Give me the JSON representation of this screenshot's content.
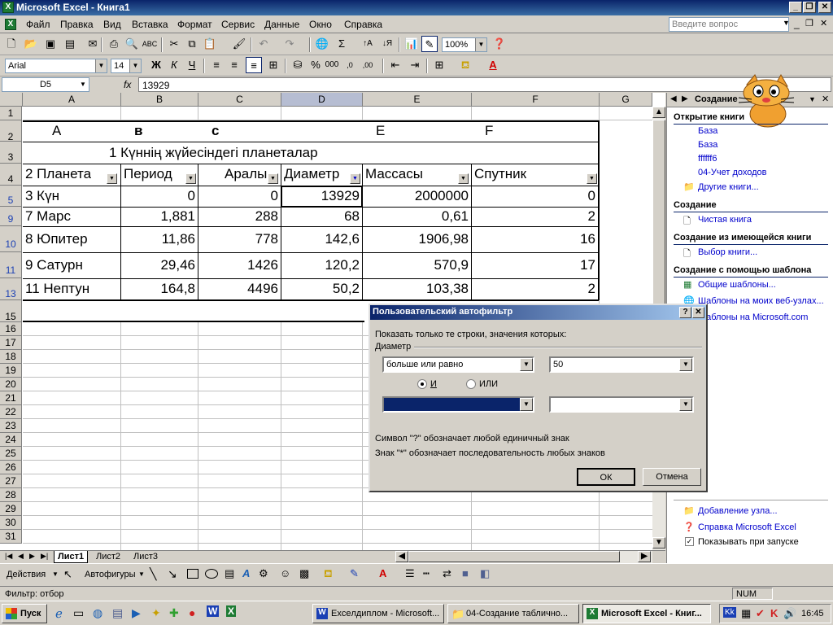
{
  "window": {
    "title": "Microsoft Excel - Книга1",
    "app_icon": "X"
  },
  "menu": {
    "items": [
      "Файл",
      "Правка",
      "Вид",
      "Вставка",
      "Формат",
      "Сервис",
      "Данные",
      "Окно",
      "Справка"
    ],
    "question_placeholder": "Введите вопрос"
  },
  "toolbar": {
    "zoom": "100%",
    "font": "Arial",
    "size": "14"
  },
  "formula": {
    "namebox": "D5",
    "fx": "fx",
    "value": "13929"
  },
  "columns": [
    "A",
    "B",
    "C",
    "D",
    "E",
    "F",
    "G"
  ],
  "rows": {
    "r1": "1",
    "r2": "2",
    "r3": "3",
    "r4": "4",
    "r5": "5",
    "r9": "9",
    "r10": "10",
    "r11": "11",
    "r13": "13",
    "r15": "15",
    "low": [
      "16",
      "17",
      "18",
      "19",
      "20",
      "21",
      "22",
      "23",
      "24",
      "25",
      "26",
      "27",
      "28",
      "29",
      "30",
      "31"
    ]
  },
  "table": {
    "letters": [
      "A",
      "в",
      "с",
      "E",
      "F"
    ],
    "title": "1  Күннің жүйесіндегі планеталар",
    "headers": [
      "2 Планета",
      "Период",
      "Аралы",
      "Диаметр",
      "Массасы",
      "Спутник"
    ],
    "rows": [
      [
        "3 Күн",
        "0",
        "0",
        "13929",
        "2000000",
        "0"
      ],
      [
        "7   Марс",
        "1,881",
        "288",
        "68",
        "0,61",
        "2"
      ],
      [
        "8   Юпитер",
        "11,86",
        "778",
        "142,6",
        "1906,98",
        "16"
      ],
      [
        "9  Сатурн",
        "29,46",
        "1426",
        "120,2",
        "570,9",
        "17"
      ],
      [
        "11 Нептун",
        "164,8",
        "4496",
        "50,2",
        "103,38",
        "2"
      ]
    ]
  },
  "sheets": {
    "tabs": [
      "Лист1",
      "Лист2",
      "Лист3"
    ]
  },
  "taskpane": {
    "title": "Создание",
    "open_heading": "Открытие книги",
    "open_links": [
      "База",
      "База",
      "ffffff6",
      "04-Учет доходов",
      "Другие книги..."
    ],
    "new_heading": "Создание",
    "blank": "Чистая книга",
    "existing_heading": "Создание из имеющейся книги",
    "choose": "Выбор книги...",
    "template_heading": "Создание с помощью шаблона",
    "template_links": [
      "Общие шаблоны...",
      "Шаблоны на моих веб-узлах...",
      "Шаблоны на Microsoft.com"
    ],
    "add_node": "Добавление узла...",
    "help": "Справка Microsoft Excel",
    "show_startup": "Показывать при запуске"
  },
  "dialog": {
    "title": "Пользовательский автофильтр",
    "prompt": "Показать только те строки, значения которых:",
    "field": "Диаметр",
    "op1": "больше или равно",
    "val1": "50",
    "and_label": "И",
    "or_label": "ИЛИ",
    "hint1": "Символ \"?\" обозначает любой единичный знак",
    "hint2": "Знак \"*\" обозначает последовательность любых знаков",
    "ok": "ОК",
    "cancel": "Отмена"
  },
  "drawbar": {
    "actions": "Действия",
    "autoshapes": "Автофигуры"
  },
  "status": {
    "left": "Фильтр: отбор",
    "num": "NUM"
  },
  "taskbar": {
    "start": "Пуск",
    "tasks": [
      "Exceлдиплом - Microsoft...",
      "04-Создание таблично...",
      "Microsoft Excel - Книг..."
    ],
    "lang": "Kk",
    "clock": "16:45"
  },
  "colors": {
    "title_bar": "#0a246a",
    "selection": "#0a246a",
    "link": "#0000cc"
  }
}
